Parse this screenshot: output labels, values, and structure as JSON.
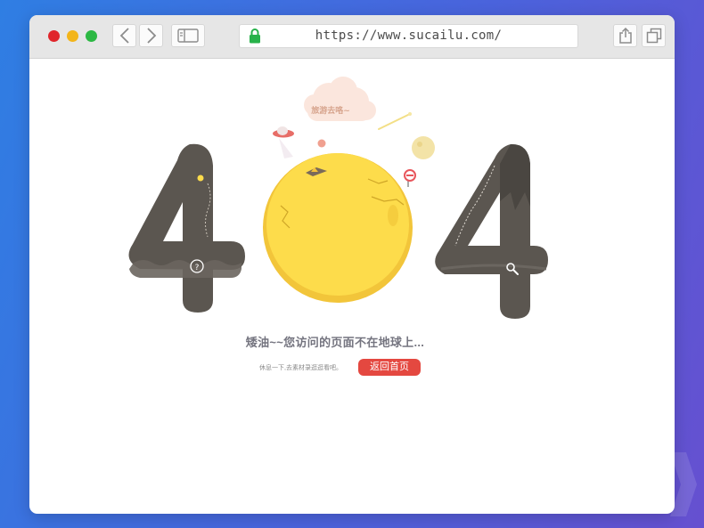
{
  "browser": {
    "url": "https://www.sucailu.com/",
    "icons": [
      "back-icon",
      "forward-icon",
      "sidebar-icon",
      "lock-icon",
      "share-icon",
      "tabs-icon"
    ]
  },
  "error_page": {
    "code_digits": [
      "4",
      "0",
      "4"
    ],
    "cloud_text": "旅游去咯~",
    "message": "矮油~~您访问的页面不在地球上...",
    "subtext": "休息一下,去素材录逛逛看吧。",
    "home_button": "返回首页"
  },
  "colors": {
    "accent_red": "#e44840",
    "moon_yellow": "#fddc4b",
    "digit_gray": "#5b5650"
  }
}
